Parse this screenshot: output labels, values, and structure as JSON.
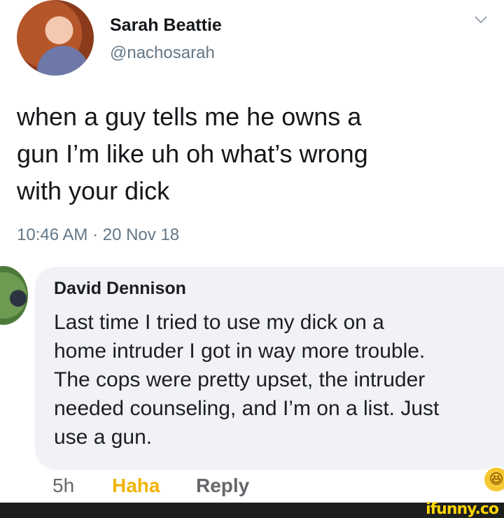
{
  "tweet": {
    "author_name": "Sarah Beattie",
    "handle": "@nachosarah",
    "text_lines": [
      "when a guy tells me he owns a",
      "gun I’m like uh oh what’s wrong",
      "with your dick"
    ],
    "timestamp": "10:46 AM · 20 Nov 18",
    "menu_icon": "chevron-down-icon"
  },
  "comment": {
    "author_name": "David Dennison",
    "text_lines": [
      "Last time I tried to use my dick on a",
      "home intruder I got in way more trouble.",
      "The cops were pretty upset, the intruder",
      "needed counseling, and I’m on a list. Just",
      "use a gun."
    ],
    "time": "5h",
    "reaction_label": "Haha",
    "reply_label": "Reply",
    "reaction_icon": "laughing-emoji-icon",
    "reaction_emoji": "😆"
  },
  "watermark": {
    "text": "ifunny.co"
  },
  "colors": {
    "bubble_bg": "#f0f2f5",
    "haha": "#f0b400",
    "muted": "#657786",
    "footer_bg": "#1e1e1e",
    "watermark": "#ffd400"
  }
}
